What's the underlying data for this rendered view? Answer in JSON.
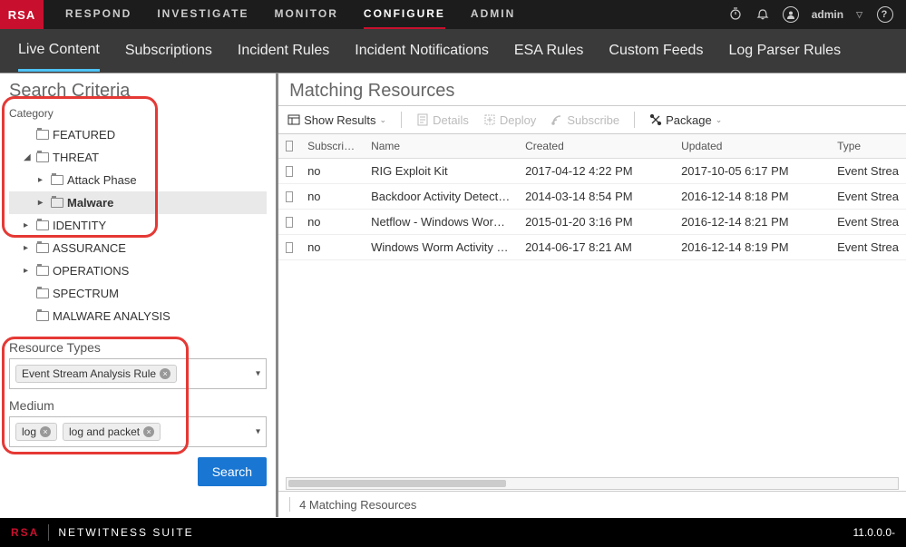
{
  "brand": {
    "logo": "RSA",
    "suite": "NETWITNESS SUITE",
    "version": "11.0.0.0-"
  },
  "topnav": {
    "items": [
      "RESPOND",
      "INVESTIGATE",
      "MONITOR",
      "CONFIGURE",
      "ADMIN"
    ],
    "active_index": 3,
    "user_label": "admin"
  },
  "subnav": {
    "items": [
      "Live Content",
      "Subscriptions",
      "Incident Rules",
      "Incident Notifications",
      "ESA Rules",
      "Custom Feeds",
      "Log Parser Rules"
    ],
    "active_index": 0
  },
  "sidebar": {
    "title": "Search Criteria",
    "category_label": "Category",
    "tree": [
      {
        "label": "FEATURED",
        "indent": 1,
        "expandable": false
      },
      {
        "label": "THREAT",
        "indent": 1,
        "expandable": true,
        "expanded": true
      },
      {
        "label": "Attack Phase",
        "indent": 2,
        "expandable": true
      },
      {
        "label": "Malware",
        "indent": 2,
        "expandable": true,
        "selected": true
      },
      {
        "label": "IDENTITY",
        "indent": 1,
        "expandable": true
      },
      {
        "label": "ASSURANCE",
        "indent": 1,
        "expandable": true
      },
      {
        "label": "OPERATIONS",
        "indent": 1,
        "expandable": true
      },
      {
        "label": "SPECTRUM",
        "indent": 1,
        "expandable": false
      },
      {
        "label": "MALWARE ANALYSIS",
        "indent": 1,
        "expandable": false
      }
    ],
    "resource_types_label": "Resource Types",
    "resource_types_values": [
      "Event Stream Analysis Rule"
    ],
    "medium_label": "Medium",
    "medium_values": [
      "log",
      "log and packet"
    ],
    "search_button": "Search"
  },
  "content": {
    "title": "Matching Resources",
    "toolbar": {
      "show_results": "Show Results",
      "details": "Details",
      "deploy": "Deploy",
      "subscribe": "Subscribe",
      "package": "Package"
    },
    "columns": {
      "subscribed": "Subscribed",
      "name": "Name",
      "created": "Created",
      "updated": "Updated",
      "type": "Type"
    },
    "rows": [
      {
        "subscribed": "no",
        "name": "RIG Exploit Kit",
        "created": "2017-04-12 4:22 PM",
        "updated": "2017-10-05 6:17 PM",
        "type": "Event Strea"
      },
      {
        "subscribed": "no",
        "name": "Backdoor Activity Detected",
        "created": "2014-03-14 8:54 PM",
        "updated": "2016-12-14 8:18 PM",
        "type": "Event Strea"
      },
      {
        "subscribed": "no",
        "name": "Netflow - Windows Worm P…",
        "created": "2015-01-20 3:16 PM",
        "updated": "2016-12-14 8:21 PM",
        "type": "Event Strea"
      },
      {
        "subscribed": "no",
        "name": "Windows Worm Activity De…",
        "created": "2014-06-17 8:21 AM",
        "updated": "2016-12-14 8:19 PM",
        "type": "Event Strea"
      }
    ],
    "status_text": "4 Matching Resources"
  }
}
